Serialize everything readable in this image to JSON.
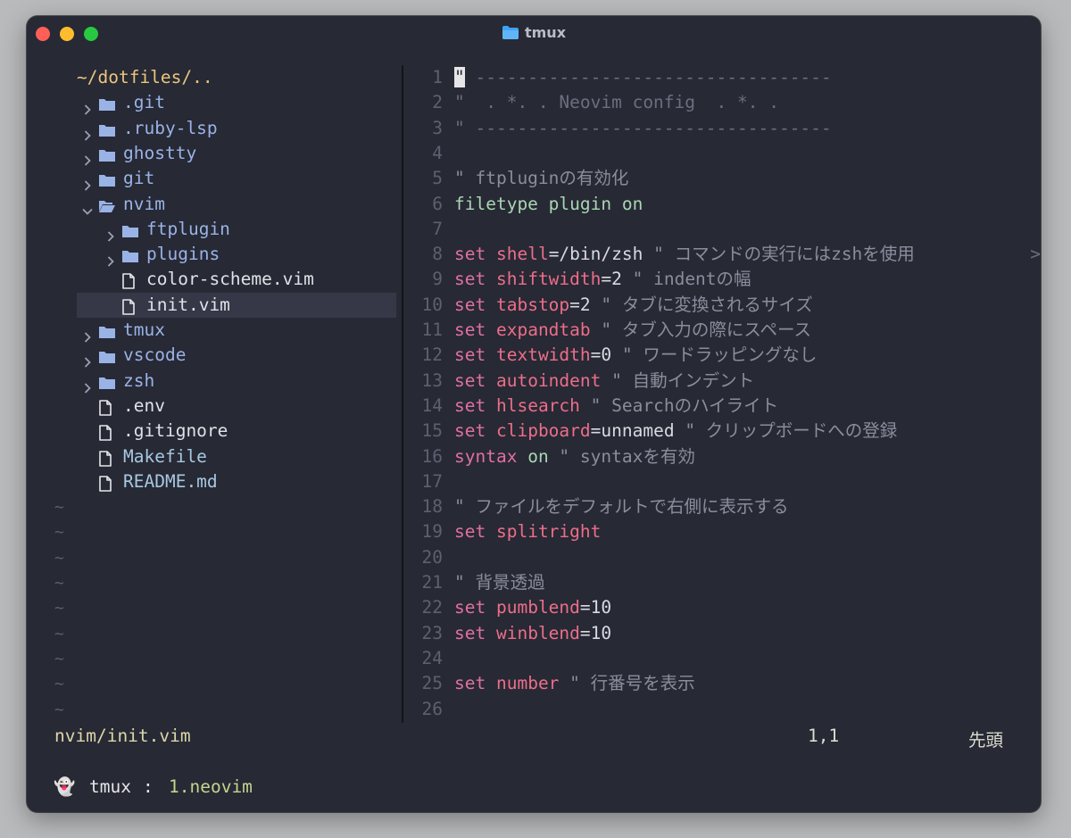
{
  "window": {
    "title": "tmux",
    "title_icon": "folder-icon"
  },
  "tree": {
    "root": "~/dotfiles/..",
    "items": [
      {
        "name": ".git",
        "kind": "dir",
        "open": false,
        "depth": 1,
        "color": "#9ab3e6"
      },
      {
        "name": ".ruby-lsp",
        "kind": "dir",
        "open": false,
        "depth": 1,
        "color": "#9ab3e6"
      },
      {
        "name": "ghostty",
        "kind": "dir",
        "open": false,
        "depth": 1,
        "color": "#9ab3e6"
      },
      {
        "name": "git",
        "kind": "dir",
        "open": false,
        "depth": 1,
        "color": "#9ab3e6"
      },
      {
        "name": "nvim",
        "kind": "dir",
        "open": true,
        "depth": 1,
        "color": "#9ab3e6"
      },
      {
        "name": "ftplugin",
        "kind": "dir",
        "open": false,
        "depth": 2,
        "color": "#9ab3e6"
      },
      {
        "name": "plugins",
        "kind": "dir",
        "open": false,
        "depth": 2,
        "color": "#9ab3e6"
      },
      {
        "name": "color-scheme.vim",
        "kind": "file",
        "depth": 2,
        "color": "#e0e1e6"
      },
      {
        "name": "init.vim",
        "kind": "file",
        "depth": 2,
        "selected": true,
        "color": "#e0e1e6"
      },
      {
        "name": "tmux",
        "kind": "dir",
        "open": false,
        "depth": 1,
        "color": "#9ab3e6"
      },
      {
        "name": "vscode",
        "kind": "dir",
        "open": false,
        "depth": 1,
        "color": "#9ab3e6"
      },
      {
        "name": "zsh",
        "kind": "dir",
        "open": false,
        "depth": 1,
        "color": "#9ab3e6"
      },
      {
        "name": ".env",
        "kind": "file",
        "depth": 1,
        "color": "#e0e1e6"
      },
      {
        "name": ".gitignore",
        "kind": "file",
        "depth": 1,
        "color": "#e0e1e6"
      },
      {
        "name": "Makefile",
        "kind": "file",
        "depth": 1,
        "color": "#a7c8e1"
      },
      {
        "name": "README.md",
        "kind": "file",
        "depth": 1,
        "color": "#a7c8e1"
      }
    ],
    "tilde": "~",
    "tilde_count": 9
  },
  "editor": {
    "lines": [
      {
        "n": "1",
        "tokens": [
          [
            "cursor",
            "\""
          ],
          [
            "dash",
            " ----------------------------------"
          ]
        ]
      },
      {
        "n": "2",
        "tokens": [
          [
            "dash",
            "\"  . *. . Neovim config  . *. ."
          ]
        ]
      },
      {
        "n": "3",
        "tokens": [
          [
            "dash",
            "\" ----------------------------------"
          ]
        ]
      },
      {
        "n": "4",
        "tokens": []
      },
      {
        "n": "5",
        "tokens": [
          [
            "cmt",
            "\" ftpluginの有効化"
          ]
        ]
      },
      {
        "n": "6",
        "tokens": [
          [
            "val",
            "filetype plugin on"
          ]
        ]
      },
      {
        "n": "7",
        "tokens": []
      },
      {
        "n": "8",
        "tokens": [
          [
            "kw",
            "set"
          ],
          [
            "txt",
            " "
          ],
          [
            "opt",
            "shell"
          ],
          [
            "txt",
            "=/bin/zsh"
          ],
          [
            "cmt",
            " \" コマンドの実行にはzshを使用"
          ]
        ],
        "overflow": ">"
      },
      {
        "n": "9",
        "tokens": [
          [
            "kw",
            "set"
          ],
          [
            "txt",
            " "
          ],
          [
            "opt",
            "shiftwidth"
          ],
          [
            "txt",
            "=2"
          ],
          [
            "cmt",
            " \" indentの幅"
          ]
        ]
      },
      {
        "n": "10",
        "tokens": [
          [
            "kw",
            "set"
          ],
          [
            "txt",
            " "
          ],
          [
            "opt",
            "tabstop"
          ],
          [
            "txt",
            "=2"
          ],
          [
            "cmt",
            " \" タブに変換されるサイズ"
          ]
        ]
      },
      {
        "n": "11",
        "tokens": [
          [
            "kw",
            "set"
          ],
          [
            "txt",
            " "
          ],
          [
            "opt",
            "expandtab"
          ],
          [
            "cmt",
            " \" タブ入力の際にスペース"
          ]
        ]
      },
      {
        "n": "12",
        "tokens": [
          [
            "kw",
            "set"
          ],
          [
            "txt",
            " "
          ],
          [
            "opt",
            "textwidth"
          ],
          [
            "txt",
            "=0"
          ],
          [
            "cmt",
            " \" ワードラッピングなし"
          ]
        ]
      },
      {
        "n": "13",
        "tokens": [
          [
            "kw",
            "set"
          ],
          [
            "txt",
            " "
          ],
          [
            "opt",
            "autoindent"
          ],
          [
            "cmt",
            " \" 自動インデント"
          ]
        ]
      },
      {
        "n": "14",
        "tokens": [
          [
            "kw",
            "set"
          ],
          [
            "txt",
            " "
          ],
          [
            "opt",
            "hlsearch"
          ],
          [
            "cmt",
            " \" Searchのハイライト"
          ]
        ]
      },
      {
        "n": "15",
        "tokens": [
          [
            "kw",
            "set"
          ],
          [
            "txt",
            " "
          ],
          [
            "opt",
            "clipboard"
          ],
          [
            "txt",
            "=unnamed"
          ],
          [
            "cmt",
            " \" クリップボードへの登録"
          ]
        ]
      },
      {
        "n": "16",
        "tokens": [
          [
            "kw",
            "syntax"
          ],
          [
            "txt",
            " "
          ],
          [
            "val",
            "on"
          ],
          [
            "cmt",
            " \" syntaxを有効"
          ]
        ]
      },
      {
        "n": "17",
        "tokens": []
      },
      {
        "n": "18",
        "tokens": [
          [
            "cmt",
            "\" ファイルをデフォルトで右側に表示する"
          ]
        ]
      },
      {
        "n": "19",
        "tokens": [
          [
            "kw",
            "set"
          ],
          [
            "txt",
            " "
          ],
          [
            "opt",
            "splitright"
          ]
        ]
      },
      {
        "n": "20",
        "tokens": []
      },
      {
        "n": "21",
        "tokens": [
          [
            "cmt",
            "\" 背景透過"
          ]
        ]
      },
      {
        "n": "22",
        "tokens": [
          [
            "kw",
            "set"
          ],
          [
            "txt",
            " "
          ],
          [
            "opt",
            "pumblend"
          ],
          [
            "txt",
            "=10"
          ]
        ]
      },
      {
        "n": "23",
        "tokens": [
          [
            "kw",
            "set"
          ],
          [
            "txt",
            " "
          ],
          [
            "opt",
            "winblend"
          ],
          [
            "txt",
            "=10"
          ]
        ]
      },
      {
        "n": "24",
        "tokens": []
      },
      {
        "n": "25",
        "tokens": [
          [
            "kw",
            "set"
          ],
          [
            "txt",
            " "
          ],
          [
            "opt",
            "number"
          ],
          [
            "cmt",
            " \" 行番号を表示"
          ]
        ]
      },
      {
        "n": "26",
        "tokens": []
      }
    ]
  },
  "statusline": {
    "file": "nvim/init.vim",
    "position": "1,1",
    "relative": "先頭"
  },
  "tmux": {
    "ghost": "👻",
    "session": "tmux",
    "separator": ":",
    "window": "1.neovim"
  }
}
